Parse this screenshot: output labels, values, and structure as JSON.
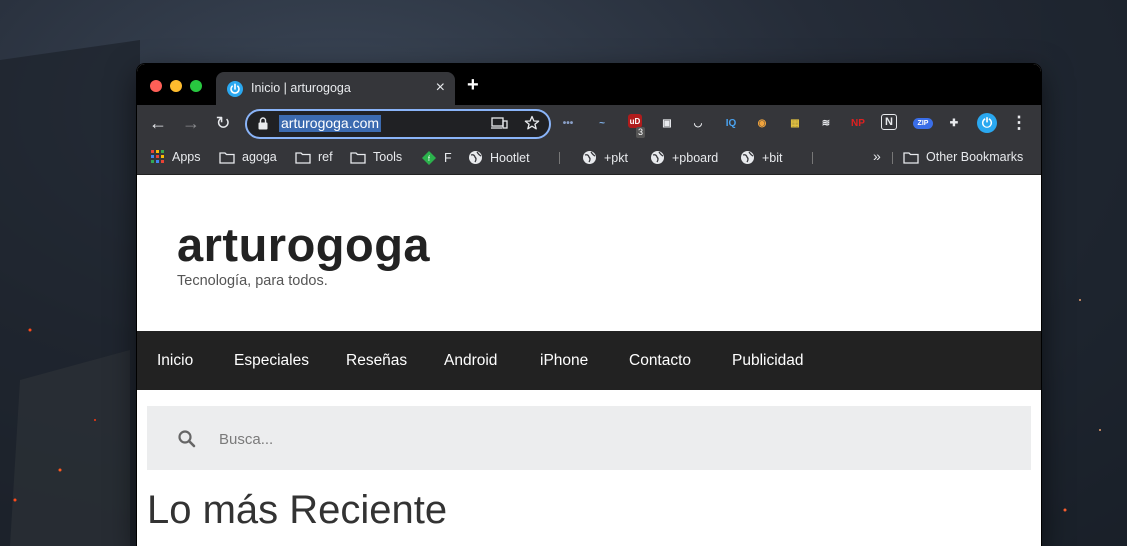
{
  "browser": {
    "tab": {
      "title": "Inicio | arturogoga",
      "close_glyph": "×"
    },
    "new_tab_glyph": "+",
    "omnibox": {
      "url": "arturogoga.com"
    },
    "nav": {
      "back": "←",
      "forward": "→",
      "reload": "↻"
    },
    "extensions": [
      {
        "name": "ext-dots-icon",
        "label": "•••",
        "color": "#8aa0c8"
      },
      {
        "name": "ext-weather-icon",
        "label": "~",
        "color": "#7fb0e8"
      },
      {
        "name": "ext-ublock-icon",
        "label": "uD",
        "badge": "3",
        "color": "#b01c1c"
      },
      {
        "name": "ext-image-icon",
        "label": "▣",
        "color": "#e8eaed"
      },
      {
        "name": "ext-pocket-icon",
        "label": "◡",
        "color": "#e8eaed"
      },
      {
        "name": "ext-iq-icon",
        "label": "IQ",
        "color": "#4aa3f0"
      },
      {
        "name": "ext-owl-icon",
        "label": "◉",
        "color": "#f0a33c"
      },
      {
        "name": "ext-colorpicker-icon",
        "label": "▦",
        "color": "#e0c040"
      },
      {
        "name": "ext-buffer-icon",
        "label": "≋",
        "color": "#e8eaed"
      },
      {
        "name": "ext-np-icon",
        "label": "NP",
        "color": "#e02020"
      },
      {
        "name": "ext-notion-icon",
        "label": "N",
        "color": "#e8eaed"
      },
      {
        "name": "ext-zip-icon",
        "label": "ZIP",
        "color": "#3a6ee8"
      },
      {
        "name": "extensions-puzzle-icon",
        "label": "✚",
        "color": "#e8eaed"
      },
      {
        "name": "ext-power-icon",
        "label": "⏻",
        "color": "#2aa8f0"
      },
      {
        "name": "menu-kebab-icon",
        "label": "⋮",
        "color": "#e8eaed"
      }
    ],
    "bookmarks": {
      "apps": "Apps",
      "items": [
        "agoga",
        "ref",
        "Tools",
        "F",
        "Hootlet",
        "+pkt",
        "+pboard",
        "+bit"
      ],
      "overflow": "»",
      "other": "Other Bookmarks"
    }
  },
  "site": {
    "title": "arturogoga",
    "tagline": "Tecnología, para todos.",
    "menu": [
      "Inicio",
      "Especiales",
      "Reseñas",
      "Android",
      "iPhone",
      "Contacto",
      "Publicidad"
    ],
    "search_placeholder": "Busca...",
    "section_heading": "Lo más Reciente"
  }
}
